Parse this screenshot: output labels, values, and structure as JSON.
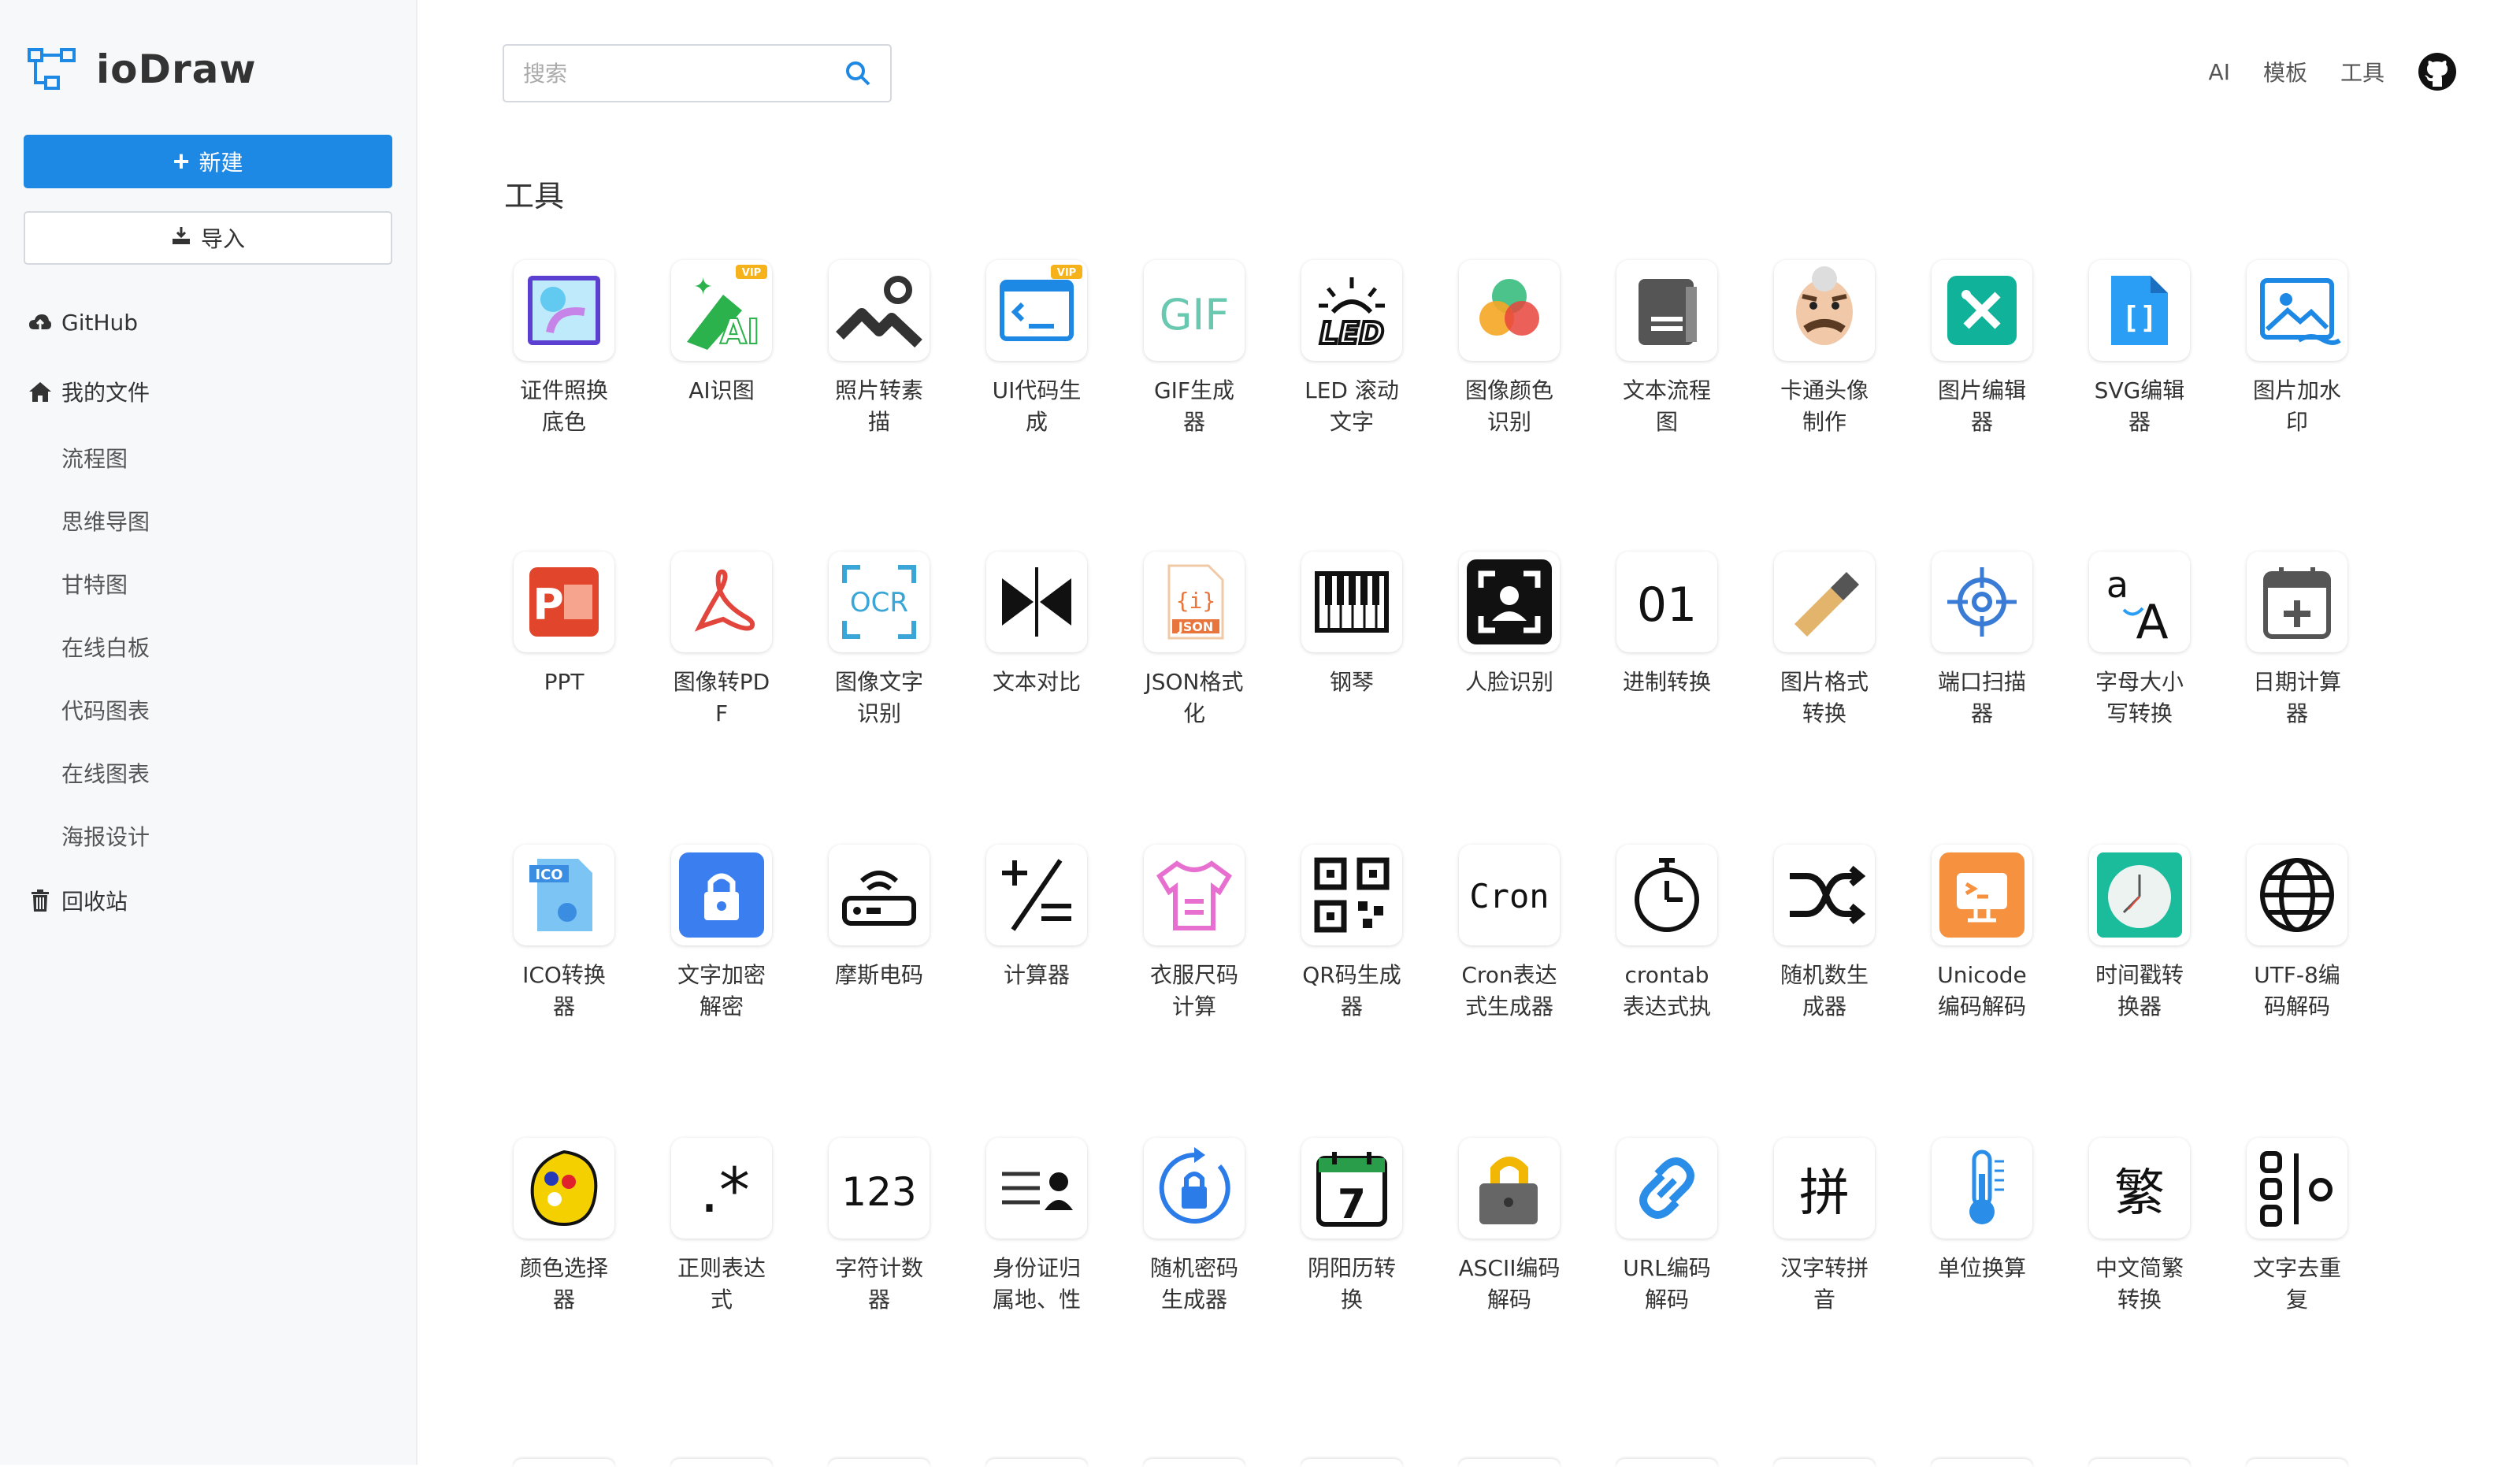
{
  "app": {
    "name": "ioDraw"
  },
  "sidebar": {
    "new_label": "新建",
    "import_label": "导入",
    "github_label": "GitHub",
    "my_files_label": "我的文件",
    "sub_items": [
      "流程图",
      "思维导图",
      "甘特图",
      "在线白板",
      "代码图表",
      "在线图表",
      "海报设计"
    ],
    "recycle_label": "回收站"
  },
  "search": {
    "placeholder": "搜索"
  },
  "topnav": {
    "ai": "AI",
    "templates": "模板",
    "tools": "工具"
  },
  "section": {
    "title": "工具"
  },
  "colors": {
    "accent": "#1e88e5",
    "sidebar_bg": "#f7f8fa"
  },
  "tools": [
    {
      "name": "证件照换底色",
      "icon": "id-photo-icon"
    },
    {
      "name": "AI识图",
      "icon": "ai-recognize-icon",
      "badge": "VIP"
    },
    {
      "name": "照片转素描",
      "icon": "sketch-icon"
    },
    {
      "name": "UI代码生成",
      "icon": "ui-code-icon",
      "badge": "VIP"
    },
    {
      "name": "GIF生成器",
      "icon": "gif-icon",
      "glyph": "GIF"
    },
    {
      "name": "LED 滚动文字",
      "icon": "led-icon",
      "glyph": "LED"
    },
    {
      "name": "图像颜色识别",
      "icon": "color-detect-icon"
    },
    {
      "name": "文本流程图",
      "icon": "text-flow-icon"
    },
    {
      "name": "卡通头像制作",
      "icon": "cartoon-avatar-icon"
    },
    {
      "name": "图片编辑器",
      "icon": "image-editor-icon"
    },
    {
      "name": "SVG编辑器",
      "icon": "svg-editor-icon"
    },
    {
      "name": "图片加水印",
      "icon": "watermark-icon"
    },
    {
      "name": "PPT",
      "icon": "ppt-icon",
      "glyph": "P"
    },
    {
      "name": "图像转PDF",
      "icon": "pdf-icon"
    },
    {
      "name": "图像文字识别",
      "icon": "ocr-icon",
      "glyph": "OCR"
    },
    {
      "name": "文本对比",
      "icon": "diff-icon"
    },
    {
      "name": "JSON格式化",
      "icon": "json-icon",
      "glyph": "JSON"
    },
    {
      "name": "钢琴",
      "icon": "piano-icon"
    },
    {
      "name": "人脸识别",
      "icon": "face-recognition-icon"
    },
    {
      "name": "进制转换",
      "icon": "base-convert-icon",
      "glyph": "01"
    },
    {
      "name": "图片格式转换",
      "icon": "image-format-icon"
    },
    {
      "name": "端口扫描器",
      "icon": "port-scan-icon"
    },
    {
      "name": "字母大小写转换",
      "icon": "letter-case-icon",
      "glyph": "aA"
    },
    {
      "name": "日期计算器",
      "icon": "date-calc-icon"
    },
    {
      "name": "ICO转换器",
      "icon": "ico-convert-icon",
      "glyph": "ICO"
    },
    {
      "name": "文字加密解密",
      "icon": "text-encrypt-icon"
    },
    {
      "name": "摩斯电码",
      "icon": "morse-icon"
    },
    {
      "name": "计算器",
      "icon": "calculator-icon"
    },
    {
      "name": "衣服尺码计算",
      "icon": "clothes-size-icon"
    },
    {
      "name": "QR码生成器",
      "icon": "qr-icon"
    },
    {
      "name": "Cron表达式生成器",
      "icon": "cron-icon",
      "glyph": "Cron"
    },
    {
      "name": "crontab表达式执",
      "icon": "crontab-icon"
    },
    {
      "name": "随机数生成器",
      "icon": "random-icon"
    },
    {
      "name": "Unicode编码解码",
      "icon": "unicode-icon"
    },
    {
      "name": "时间戳转换器",
      "icon": "timestamp-icon"
    },
    {
      "name": "UTF-8编码解码",
      "icon": "utf8-icon"
    },
    {
      "name": "颜色选择器",
      "icon": "color-picker-icon"
    },
    {
      "name": "正则表达式",
      "icon": "regex-icon",
      "glyph": ".*"
    },
    {
      "name": "字符计数器",
      "icon": "char-count-icon",
      "glyph": "123"
    },
    {
      "name": "身份证归属地、性",
      "icon": "id-card-icon"
    },
    {
      "name": "随机密码生成器",
      "icon": "password-icon"
    },
    {
      "name": "阴阳历转换",
      "icon": "lunar-calendar-icon",
      "glyph": "7"
    },
    {
      "name": "ASCII编码解码",
      "icon": "ascii-icon"
    },
    {
      "name": "URL编码解码",
      "icon": "url-icon"
    },
    {
      "name": "汉字转拼音",
      "icon": "pinyin-icon",
      "glyph": "拼"
    },
    {
      "name": "单位换算",
      "icon": "unit-convert-icon"
    },
    {
      "name": "中文简繁转换",
      "icon": "traditional-chinese-icon",
      "glyph": "繁"
    },
    {
      "name": "文字去重复",
      "icon": "dedupe-icon",
      "glyph": "8|o"
    }
  ]
}
